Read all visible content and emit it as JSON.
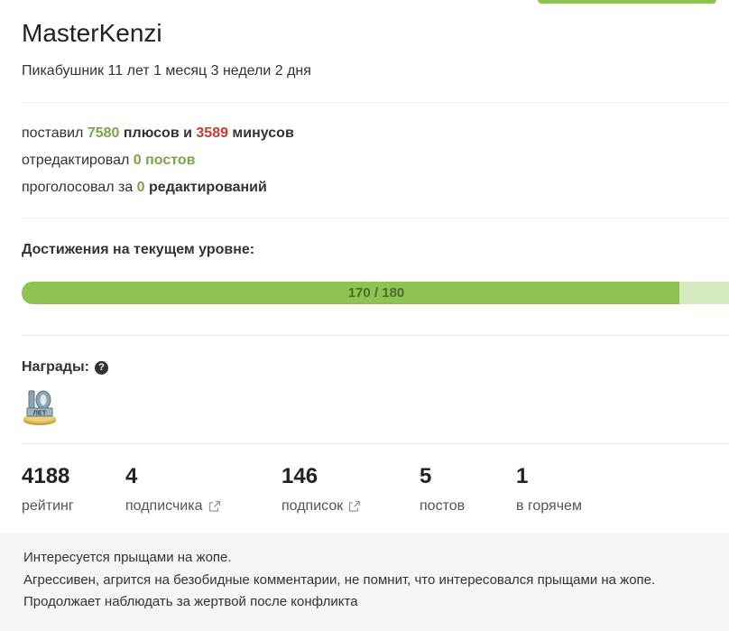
{
  "profile": {
    "username": "MasterKenzi",
    "tenure": "Пикабушник 11 лет 1 месяц 3 недели 2 дня"
  },
  "stats": {
    "line1": {
      "prefix": "поставил ",
      "pluses": "7580",
      "mid": " плюсов и ",
      "minuses": "3589",
      "suffix": " минусов"
    },
    "line2": {
      "prefix": "отредактировал ",
      "value": "0 постов"
    },
    "line3": {
      "prefix": "проголосовал за ",
      "value": "0",
      "suffix": " редактирований"
    }
  },
  "achievements": {
    "title": "Достижения на текущем уровне:",
    "progress_label": "170 / 180",
    "current": 170,
    "max": 180,
    "fill_color": "#8fc351",
    "track_color": "#d6ecc0"
  },
  "awards": {
    "title": "Награды:",
    "help_icon": "question-circle-icon",
    "badge_text": "10",
    "badge_subtext": "ЛЕТ"
  },
  "counters": [
    {
      "value": "4188",
      "label": "рейтинг",
      "external": false
    },
    {
      "value": "4",
      "label": "подписчика",
      "external": true
    },
    {
      "value": "146",
      "label": "подписок",
      "external": true
    },
    {
      "value": "5",
      "label": "постов",
      "external": false
    },
    {
      "value": "1",
      "label": "в горячем",
      "external": false
    }
  ],
  "note": {
    "line1": "Интересуется прыщами на жопе.",
    "line2": "Агрессивен, агрится на безобидные комментарии, не помнит, что интересовался прыщами на жопе.",
    "line3": "Продолжает наблюдать за жертвой после конфликта"
  },
  "colors": {
    "accent_green": "#79a644",
    "minus_red": "#d0382b"
  }
}
